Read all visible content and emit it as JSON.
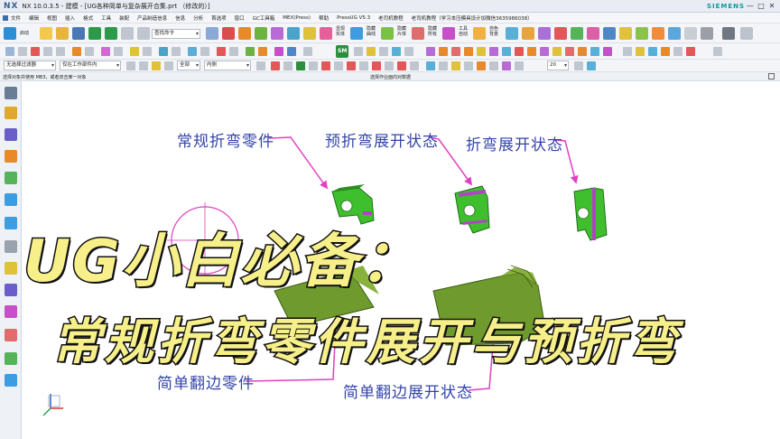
{
  "window": {
    "logo": "NX",
    "title": "NX 10.0.3.5 - 建模 - [UG各种简单与复杂展开合集.prt （修改的）]",
    "brand": "SIEMENS",
    "minimize": "—",
    "maximize": "□",
    "close": "✕"
  },
  "menubar": {
    "items": [
      "文件",
      "编辑",
      "视图",
      "插入",
      "格式",
      "工具",
      "装配",
      "产品制造信息",
      "信息",
      "分析",
      "首选项",
      "窗口",
      "GC工具箱",
      "MEX(Press)",
      "帮助",
      "PressUG V5.3",
      "老司机教程",
      "老司机教程（学习本压模具设计加微信3635986038）"
    ]
  },
  "toolbar": {
    "start_label": "启动",
    "command_finder_placeholder": "查找命令",
    "sm_label": "SM",
    "labels": [
      "显现实体",
      "隐藏曲线",
      "隐藏片体",
      "隐藏所有",
      "工具自动",
      "自色背景"
    ],
    "selection_filter": "无选择过滤器",
    "scope": "仅在工作部件内",
    "assembly": "全部",
    "snap": "内侧",
    "zoom_value": "20"
  },
  "statusbar": {
    "prompt": "选择对象并使用 MB3，或者双击某一对象",
    "status": "选择作业面向对数据"
  },
  "annotations": {
    "regular_bend_part": "常规折弯零件",
    "prebend_unfold_state": "预折弯展开状态",
    "bend_unfold_state": "折弯展开状态",
    "simple_flange_part": "简单翻边零件",
    "simple_flange_unfold_state": "简单翻边展开状态"
  },
  "overlay_title": {
    "line1": "UG小白必备：",
    "line2": "常规折弯零件展开与预折弯"
  },
  "colors": {
    "annotation_text": "#3344aa",
    "arrow": "#e040c0",
    "part_green": "#3fbf2e",
    "flange_olive": "#6f9a2d",
    "title_fill": "#f7f08a",
    "title_stroke": "#111111"
  }
}
